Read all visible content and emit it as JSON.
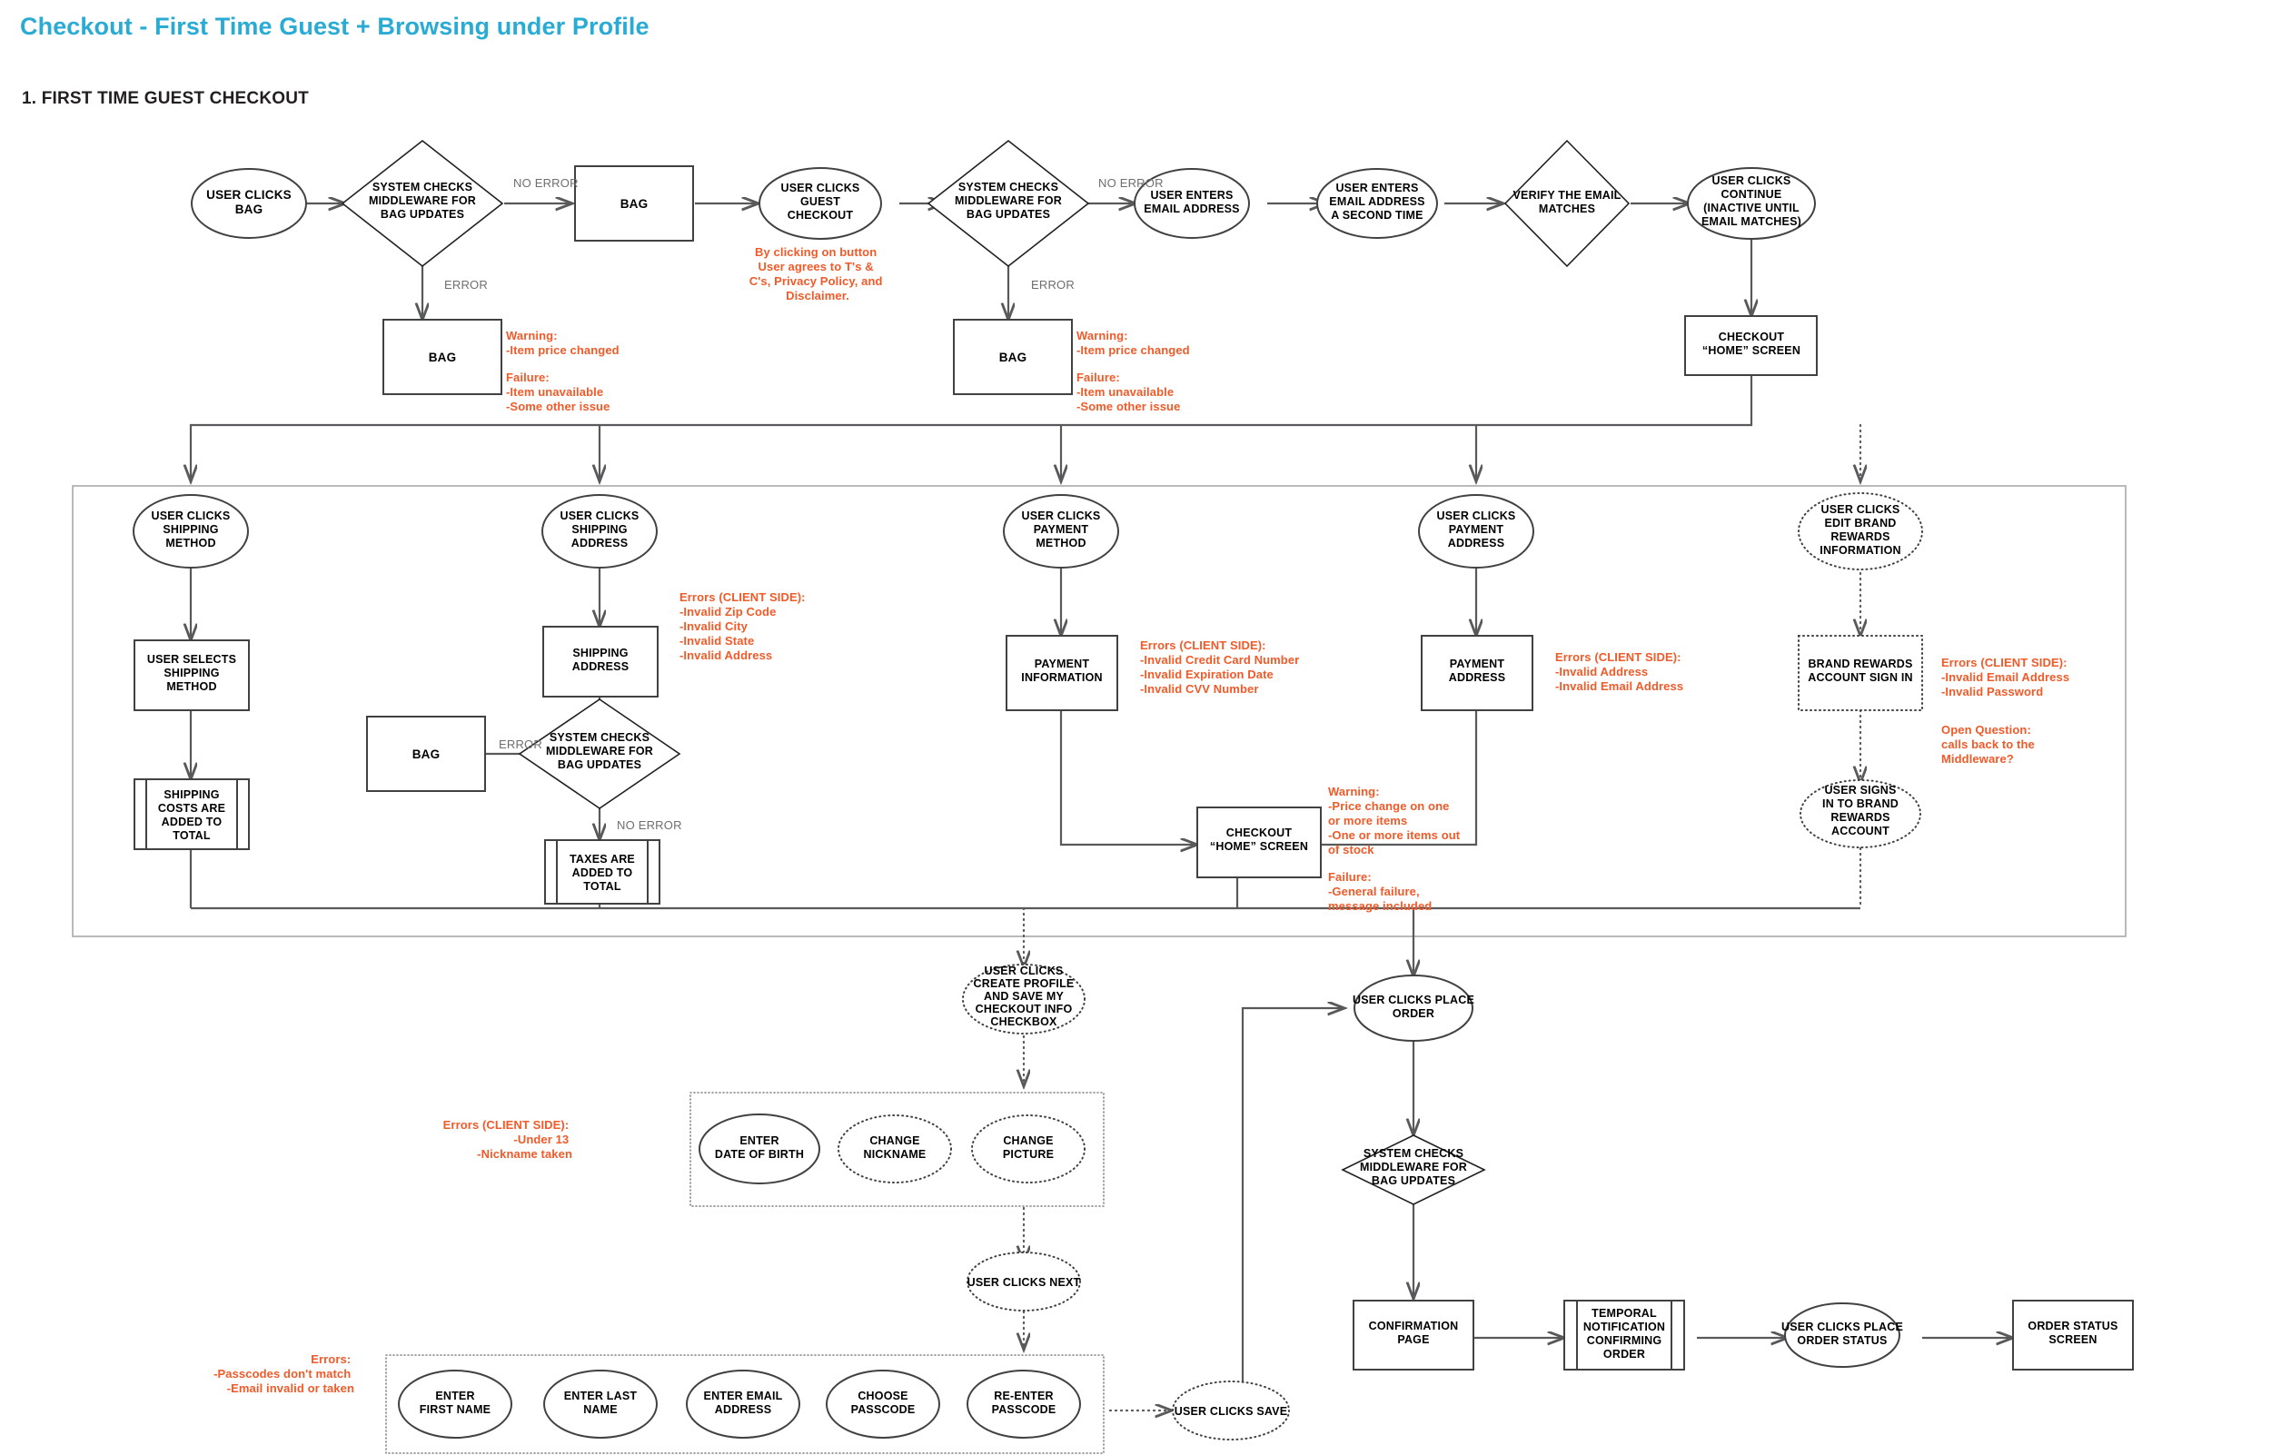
{
  "page": {
    "title": "Checkout - First Time Guest + Browsing under Profile",
    "section_title": "1. FIRST TIME GUEST CHECKOUT",
    "title_color": "#29abd4",
    "note_color": "#f15a29",
    "edge_label_color": "#6d6e71"
  },
  "chart_data": {
    "type": "diagram",
    "title": "Checkout - First Time Guest + Browsing under Profile",
    "subtitle": "1. FIRST TIME GUEST CHECKOUT"
  },
  "nodes": {
    "n01": {
      "label": [
        "USER CLICKS",
        "BAG"
      ],
      "shape": "ellipse",
      "style": "solid"
    },
    "n02": {
      "label": [
        "SYSTEM CHECKS",
        "MIDDLEWARE FOR",
        "BAG UPDATES"
      ],
      "shape": "diamond",
      "style": "solid"
    },
    "n03": {
      "label": [
        "BAG"
      ],
      "shape": "rect",
      "style": "solid"
    },
    "n04": {
      "label": [
        "BAG"
      ],
      "shape": "rect",
      "style": "solid"
    },
    "n05": {
      "label": [
        "USER CLICKS",
        "GUEST",
        "CHECKOUT"
      ],
      "shape": "ellipse",
      "style": "solid"
    },
    "n06": {
      "label": [
        "SYSTEM CHECKS",
        "MIDDLEWARE FOR",
        "BAG UPDATES"
      ],
      "shape": "diamond",
      "style": "solid"
    },
    "n07": {
      "label": [
        "BAG"
      ],
      "shape": "rect",
      "style": "solid"
    },
    "n08": {
      "label": [
        "USER ENTERS",
        "EMAIL ADDRESS"
      ],
      "shape": "ellipse",
      "style": "solid"
    },
    "n09": {
      "label": [
        "USER ENTERS",
        "EMAIL ADDRESS",
        "A SECOND TIME"
      ],
      "shape": "ellipse",
      "style": "solid"
    },
    "n10": {
      "label": [
        "VERIFY THE EMAIL",
        "MATCHES"
      ],
      "shape": "diamond",
      "style": "solid"
    },
    "n11": {
      "label": [
        "USER CLICKS",
        "CONTINUE",
        "(INACTIVE UNTIL",
        "EMAIL MATCHES)"
      ],
      "shape": "ellipse",
      "style": "solid"
    },
    "n12": {
      "label": [
        "CHECKOUT",
        "“HOME” SCREEN"
      ],
      "shape": "rect",
      "style": "solid"
    },
    "n13": {
      "label": [
        "USER CLICKS",
        "SHIPPING",
        "METHOD"
      ],
      "shape": "ellipse",
      "style": "solid"
    },
    "n14": {
      "label": [
        "USER SELECTS",
        "SHIPPING",
        "METHOD"
      ],
      "shape": "rect",
      "style": "solid"
    },
    "n15": {
      "label": [
        "SHIPPING",
        "COSTS ARE",
        "ADDED TO",
        "TOTAL"
      ],
      "shape": "predefined",
      "style": "solid"
    },
    "n16": {
      "label": [
        "USER CLICKS",
        "SHIPPING",
        "ADDRESS"
      ],
      "shape": "ellipse",
      "style": "solid"
    },
    "n17": {
      "label": [
        "SHIPPING",
        "ADDRESS"
      ],
      "shape": "rect",
      "style": "solid"
    },
    "n18": {
      "label": [
        "SYSTEM CHECKS",
        "MIDDLEWARE FOR",
        "BAG UPDATES"
      ],
      "shape": "diamond",
      "style": "solid"
    },
    "n19": {
      "label": [
        "BAG"
      ],
      "shape": "rect",
      "style": "solid"
    },
    "n20": {
      "label": [
        "TAXES ARE",
        "ADDED TO",
        "TOTAL"
      ],
      "shape": "predefined",
      "style": "solid"
    },
    "n21": {
      "label": [
        "USER CLICKS",
        "PAYMENT",
        "METHOD"
      ],
      "shape": "ellipse",
      "style": "solid"
    },
    "n22": {
      "label": [
        "PAYMENT",
        "INFORMATION"
      ],
      "shape": "rect",
      "style": "solid"
    },
    "n23": {
      "label": [
        "USER CLICKS",
        "PAYMENT",
        "ADDRESS"
      ],
      "shape": "ellipse",
      "style": "solid"
    },
    "n24": {
      "label": [
        "PAYMENT",
        "ADDRESS"
      ],
      "shape": "rect",
      "style": "solid"
    },
    "n25": {
      "label": [
        "USER CLICKS",
        "EDIT BRAND",
        "REWARDS",
        "INFORMATION"
      ],
      "shape": "ellipse",
      "style": "dotted"
    },
    "n26": {
      "label": [
        "BRAND REWARDS",
        "ACCOUNT SIGN IN"
      ],
      "shape": "rect",
      "style": "dotted"
    },
    "n27": {
      "label": [
        "USER SIGNS",
        "IN TO BRAND",
        "REWARDS",
        "ACCOUNT"
      ],
      "shape": "ellipse",
      "style": "dotted"
    },
    "n28": {
      "label": [
        "CHECKOUT",
        "“HOME” SCREEN"
      ],
      "shape": "rect",
      "style": "solid"
    },
    "n29": {
      "label": [
        "USER CLICKS",
        "CREATE PROFILE",
        "AND SAVE MY",
        "CHECKOUT INFO",
        "CHECKBOX"
      ],
      "shape": "ellipse",
      "style": "dotted"
    },
    "n30": {
      "label": [
        "ENTER",
        "DATE OF BIRTH"
      ],
      "shape": "ellipse",
      "style": "solid"
    },
    "n31": {
      "label": [
        "CHANGE",
        "NICKNAME"
      ],
      "shape": "ellipse",
      "style": "dotted"
    },
    "n32": {
      "label": [
        "CHANGE",
        "PICTURE"
      ],
      "shape": "ellipse",
      "style": "dotted"
    },
    "n33": {
      "label": [
        "USER CLICKS NEXT"
      ],
      "shape": "ellipse",
      "style": "dotted"
    },
    "n34": {
      "label": [
        "ENTER",
        "FIRST NAME"
      ],
      "shape": "ellipse",
      "style": "solid"
    },
    "n35": {
      "label": [
        "ENTER LAST",
        "NAME"
      ],
      "shape": "ellipse",
      "style": "solid"
    },
    "n36": {
      "label": [
        "ENTER EMAIL",
        "ADDRESS"
      ],
      "shape": "ellipse",
      "style": "solid"
    },
    "n37": {
      "label": [
        "CHOOSE",
        "PASSCODE"
      ],
      "shape": "ellipse",
      "style": "solid"
    },
    "n38": {
      "label": [
        "RE-ENTER",
        "PASSCODE"
      ],
      "shape": "ellipse",
      "style": "solid"
    },
    "n39": {
      "label": [
        "USER CLICKS SAVE"
      ],
      "shape": "ellipse",
      "style": "dotted"
    },
    "n40": {
      "label": [
        "USER CLICKS PLACE",
        "ORDER"
      ],
      "shape": "ellipse",
      "style": "solid"
    },
    "n41": {
      "label": [
        "SYSTEM CHECKS",
        "MIDDLEWARE FOR",
        "BAG UPDATES"
      ],
      "shape": "diamond",
      "style": "solid"
    },
    "n42": {
      "label": [
        "CONFIRMATION",
        "PAGE"
      ],
      "shape": "rect",
      "style": "solid"
    },
    "n43": {
      "label": [
        "TEMPORAL",
        "NOTIFICATION",
        "CONFIRMING",
        "ORDER"
      ],
      "shape": "predefined",
      "style": "solid"
    },
    "n44": {
      "label": [
        "USER CLICKS PLACE",
        "ORDER STATUS"
      ],
      "shape": "ellipse",
      "style": "solid"
    },
    "n45": {
      "label": [
        "ORDER STATUS",
        "SCREEN"
      ],
      "shape": "rect",
      "style": "solid"
    }
  },
  "edge_labels": {
    "e1": "NO ERROR",
    "e2": "ERROR",
    "e3": "NO ERROR",
    "e4": "ERROR",
    "e5": "ERROR",
    "e6": "NO ERROR"
  },
  "notes": {
    "guest_checkout_disclaimer": [
      "By clicking on button",
      "User agrees to T's &",
      "C's, Privacy Policy, and",
      "Disclaimer."
    ],
    "bag_error_1": [
      "Warning:",
      "-Item price changed",
      "",
      "Failure:",
      "-Item unavailable",
      "-Some other issue"
    ],
    "bag_error_2": [
      "Warning:",
      "-Item price changed",
      "",
      "Failure:",
      "-Item unavailable",
      "-Some other issue"
    ],
    "shipping_address_errors": [
      "Errors (CLIENT SIDE):",
      "-Invalid Zip Code",
      "-Invalid City",
      "-Invalid State",
      "-Invalid Address"
    ],
    "payment_info_errors": [
      "Errors (CLIENT SIDE):",
      "-Invalid Credit Card Number",
      "-Invalid Expiration Date",
      "-Invalid CVV Number"
    ],
    "payment_address_errors": [
      "Errors (CLIENT SIDE):",
      "-Invalid Address",
      "-Invalid Email Address"
    ],
    "brand_rewards_errors": [
      "Errors (CLIENT SIDE):",
      "-Invalid Email Address",
      "-Invalid Password"
    ],
    "open_question": [
      "Open Question:",
      "calls back to the",
      "Middleware?"
    ],
    "checkout_home_warning": [
      "Warning:",
      "-Price change on one",
      "or more items",
      "-One or more items out",
      "of stock",
      "",
      "Failure:",
      "-General failure,",
      "message included"
    ],
    "profile_errors": [
      "Errors (CLIENT SIDE):",
      "-Under 13",
      "-Nickname taken"
    ],
    "signup_errors": [
      "Errors:",
      "-Passcodes don't match",
      "-Email invalid or taken"
    ]
  }
}
